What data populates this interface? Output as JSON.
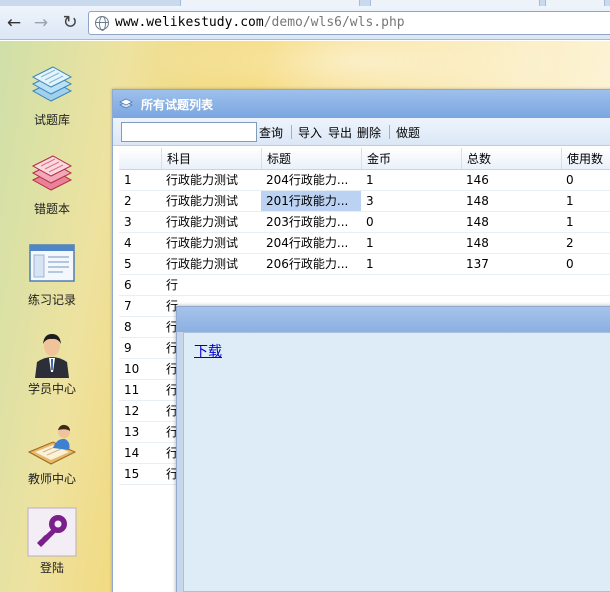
{
  "browser": {
    "url_host": "www.welikestudy.com",
    "url_path": "/demo/wls6/wls.php"
  },
  "nav": {
    "items": [
      {
        "label": "试题库",
        "icon": "question-bank-icon"
      },
      {
        "label": "错题本",
        "icon": "wrong-answers-icon"
      },
      {
        "label": "练习记录",
        "icon": "practice-record-icon"
      },
      {
        "label": "学员中心",
        "icon": "student-center-icon"
      },
      {
        "label": "教师中心",
        "icon": "teacher-center-icon"
      },
      {
        "label": "登陆",
        "icon": "key-icon"
      }
    ]
  },
  "main_window": {
    "title": "所有试题列表",
    "toolbar": {
      "search_value": "",
      "query_label": "查询",
      "import_label": "导入",
      "export_label": "导出",
      "delete_label": "删除",
      "practice_label": "做题"
    },
    "grid": {
      "columns": [
        "",
        "科目",
        "标题",
        "金币",
        "总数",
        "使用数"
      ],
      "rows": [
        [
          "1",
          "行政能力测试",
          "204行政能力...",
          "1",
          "146",
          "0"
        ],
        [
          "2",
          "行政能力测试",
          "201行政能力...",
          "3",
          "148",
          "1"
        ],
        [
          "3",
          "行政能力测试",
          "203行政能力...",
          "0",
          "148",
          "1"
        ],
        [
          "4",
          "行政能力测试",
          "204行政能力...",
          "1",
          "148",
          "2"
        ],
        [
          "5",
          "行政能力测试",
          "206行政能力...",
          "1",
          "137",
          "0"
        ],
        [
          "6",
          "行",
          "",
          "",
          "",
          ""
        ],
        [
          "7",
          "行",
          "",
          "",
          "",
          ""
        ],
        [
          "8",
          "行",
          "",
          "",
          "",
          ""
        ],
        [
          "9",
          "行",
          "",
          "",
          "",
          ""
        ],
        [
          "10",
          "行",
          "",
          "",
          "",
          ""
        ],
        [
          "11",
          "行",
          "",
          "",
          "",
          ""
        ],
        [
          "12",
          "行",
          "",
          "",
          "",
          ""
        ],
        [
          "13",
          "行",
          "",
          "",
          "",
          ""
        ],
        [
          "14",
          "行",
          "",
          "",
          "",
          ""
        ],
        [
          "15",
          "行",
          "",
          "",
          "",
          ""
        ]
      ],
      "selected_row": 2,
      "selected_col": 2
    }
  },
  "dialog": {
    "link_label": "下载"
  },
  "colors": {
    "titlebar": "#7aa6e0",
    "selection": "#bcd2f2",
    "link": "#0000cc"
  }
}
